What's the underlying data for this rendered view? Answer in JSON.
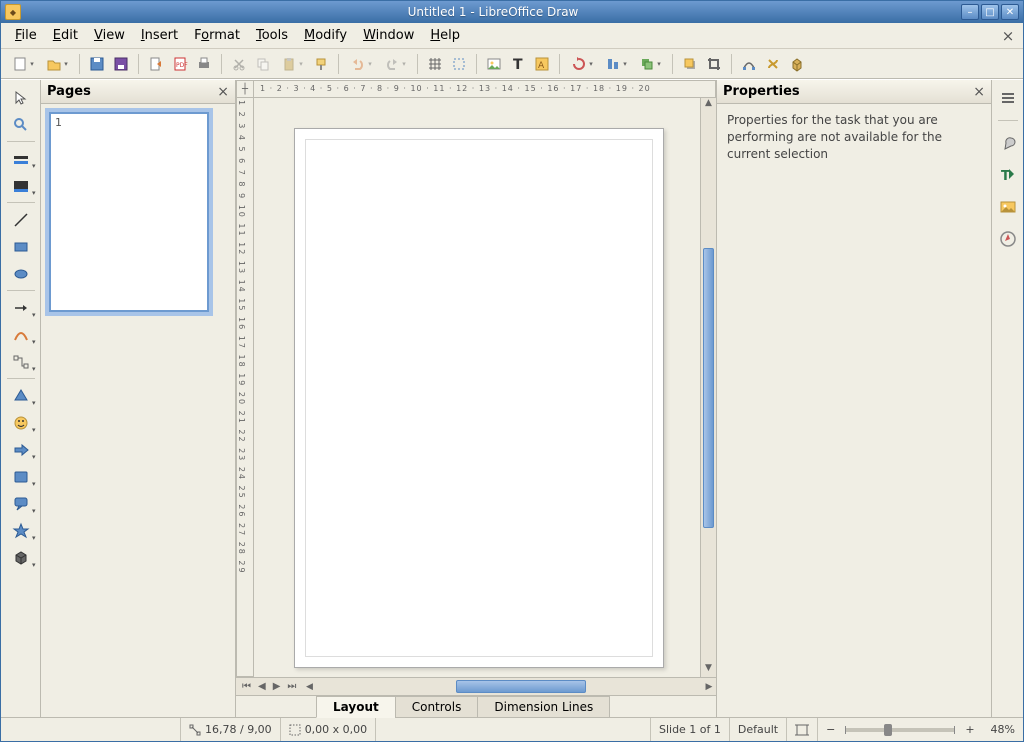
{
  "window": {
    "title": "Untitled 1 - LibreOffice Draw"
  },
  "menu": {
    "file": "File",
    "edit": "Edit",
    "view": "View",
    "insert": "Insert",
    "format": "Format",
    "tools": "Tools",
    "modify": "Modify",
    "window": "Window",
    "help": "Help"
  },
  "pages_panel": {
    "title": "Pages",
    "slide_number": "1"
  },
  "properties_panel": {
    "title": "Properties",
    "message": "Properties for the task that you are performing are not available for the current selection"
  },
  "sheet_tabs": {
    "layout": "Layout",
    "controls": "Controls",
    "dimension": "Dimension Lines"
  },
  "statusbar": {
    "cursor_pos": "16,78 / 9,00",
    "object_size": "0,00 x 0,00",
    "slide_of": "Slide 1 of 1",
    "style": "Default",
    "zoom": "48%",
    "zoom_minus": "−",
    "zoom_plus": "+"
  },
  "ruler_h": "1 · 2 · 3 · 4 · 5 · 6 · 7 · 8 · 9 · 10 · 11 · 12 · 13 · 14 · 15 · 16 · 17 · 18 · 19 · 20",
  "ruler_v": "1 2 3 4 5 6 7 8 9 10 11 12 13 14 15 16 17 18 19 20 21 22 23 24 25 26 27 28 29"
}
